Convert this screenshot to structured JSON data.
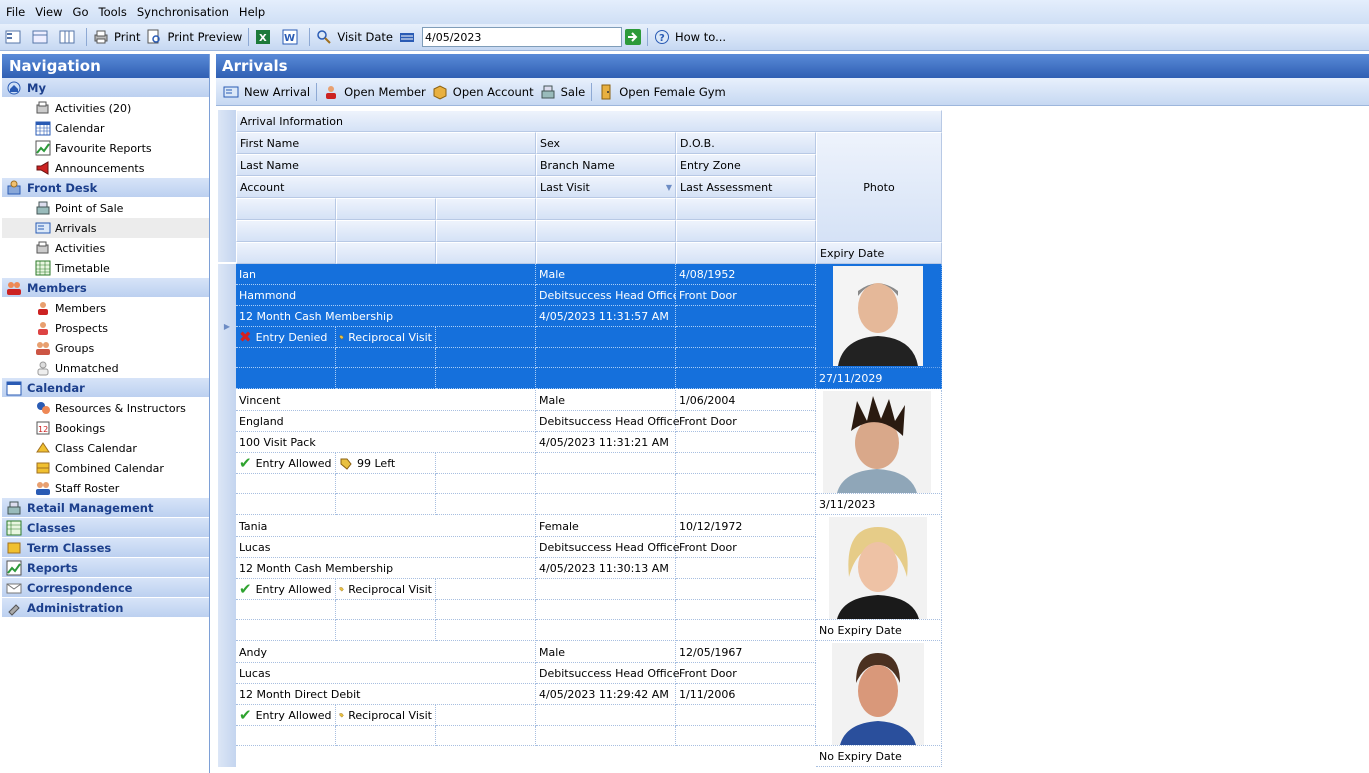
{
  "menu": [
    "File",
    "View",
    "Go",
    "Tools",
    "Synchronisation",
    "Help"
  ],
  "toolbar": {
    "print": "Print",
    "print_preview": "Print Preview",
    "visit_date_label": "Visit Date",
    "visit_date_value": "4/05/2023",
    "how_to": "How to..."
  },
  "nav": {
    "title": "Navigation",
    "groups": [
      {
        "label": "My",
        "items": [
          "Activities (20)",
          "Calendar",
          "Favourite Reports",
          "Announcements"
        ]
      },
      {
        "label": "Front Desk",
        "items": [
          "Point of Sale",
          "Arrivals",
          "Activities",
          "Timetable"
        ]
      },
      {
        "label": "Members",
        "items": [
          "Members",
          "Prospects",
          "Groups",
          "Unmatched"
        ]
      },
      {
        "label": "Calendar",
        "items": [
          "Resources & Instructors",
          "Bookings",
          "Class Calendar",
          "Combined Calendar",
          "Staff Roster"
        ]
      },
      {
        "label": "Retail Management",
        "items": []
      },
      {
        "label": "Classes",
        "items": []
      },
      {
        "label": "Term Classes",
        "items": []
      },
      {
        "label": "Reports",
        "items": []
      },
      {
        "label": "Correspondence",
        "items": []
      },
      {
        "label": "Administration",
        "items": []
      }
    ],
    "selected": "Arrivals"
  },
  "main": {
    "title": "Arrivals",
    "actions": [
      "New Arrival",
      "Open Member",
      "Open Account",
      "Sale",
      "Open Female Gym"
    ]
  },
  "grid": {
    "band": "Arrival Information",
    "headers": {
      "first_name": "First Name",
      "sex": "Sex",
      "dob": "D.O.B.",
      "last_name": "Last Name",
      "branch": "Branch Name",
      "entry_zone": "Entry Zone",
      "account": "Account",
      "last_visit": "Last Visit",
      "last_assessment": "Last Assessment",
      "photo": "Photo",
      "expiry": "Expiry Date"
    },
    "records": [
      {
        "first": "Ian",
        "last": "Hammond",
        "account": "12 Month Cash Membership",
        "sex": "Male",
        "branch": "Debitsuccess Head Office",
        "last_visit": "4/05/2023 11:31:57 AM",
        "dob": "4/08/1952",
        "zone": "Front Door",
        "assessment": "",
        "entry": "Entry Denied",
        "visit_type": "Reciprocal Visit",
        "expiry": "27/11/2029",
        "selected": true
      },
      {
        "first": "Vincent",
        "last": "England",
        "account": "100 Visit Pack",
        "sex": "Male",
        "branch": "Debitsuccess Head Office",
        "last_visit": "4/05/2023 11:31:21 AM",
        "dob": "1/06/2004",
        "zone": "Front Door",
        "assessment": "",
        "entry": "Entry Allowed",
        "visit_type": "99 Left",
        "expiry": "3/11/2023",
        "selected": false
      },
      {
        "first": "Tania",
        "last": "Lucas",
        "account": "12 Month Cash Membership",
        "sex": "Female",
        "branch": "Debitsuccess Head Office",
        "last_visit": "4/05/2023 11:30:13 AM",
        "dob": "10/12/1972",
        "zone": "Front Door",
        "assessment": "",
        "entry": "Entry Allowed",
        "visit_type": "Reciprocal Visit",
        "expiry": "No Expiry Date",
        "selected": false
      },
      {
        "first": "Andy",
        "last": "Lucas",
        "account": "12 Month Direct Debit",
        "sex": "Male",
        "branch": "Debitsuccess Head Office",
        "last_visit": "4/05/2023 11:29:42 AM",
        "dob": "12/05/1967",
        "zone": "Front Door",
        "assessment": "1/11/2006",
        "entry": "Entry Allowed",
        "visit_type": "Reciprocal Visit",
        "expiry": "No Expiry Date",
        "selected": false
      }
    ]
  },
  "colors": {
    "selection": "#1570dc",
    "header": "#2f5fb3",
    "nav_group": "#1c3f8c",
    "entry_allowed": "#2fa32f",
    "entry_denied": "#d42020"
  }
}
